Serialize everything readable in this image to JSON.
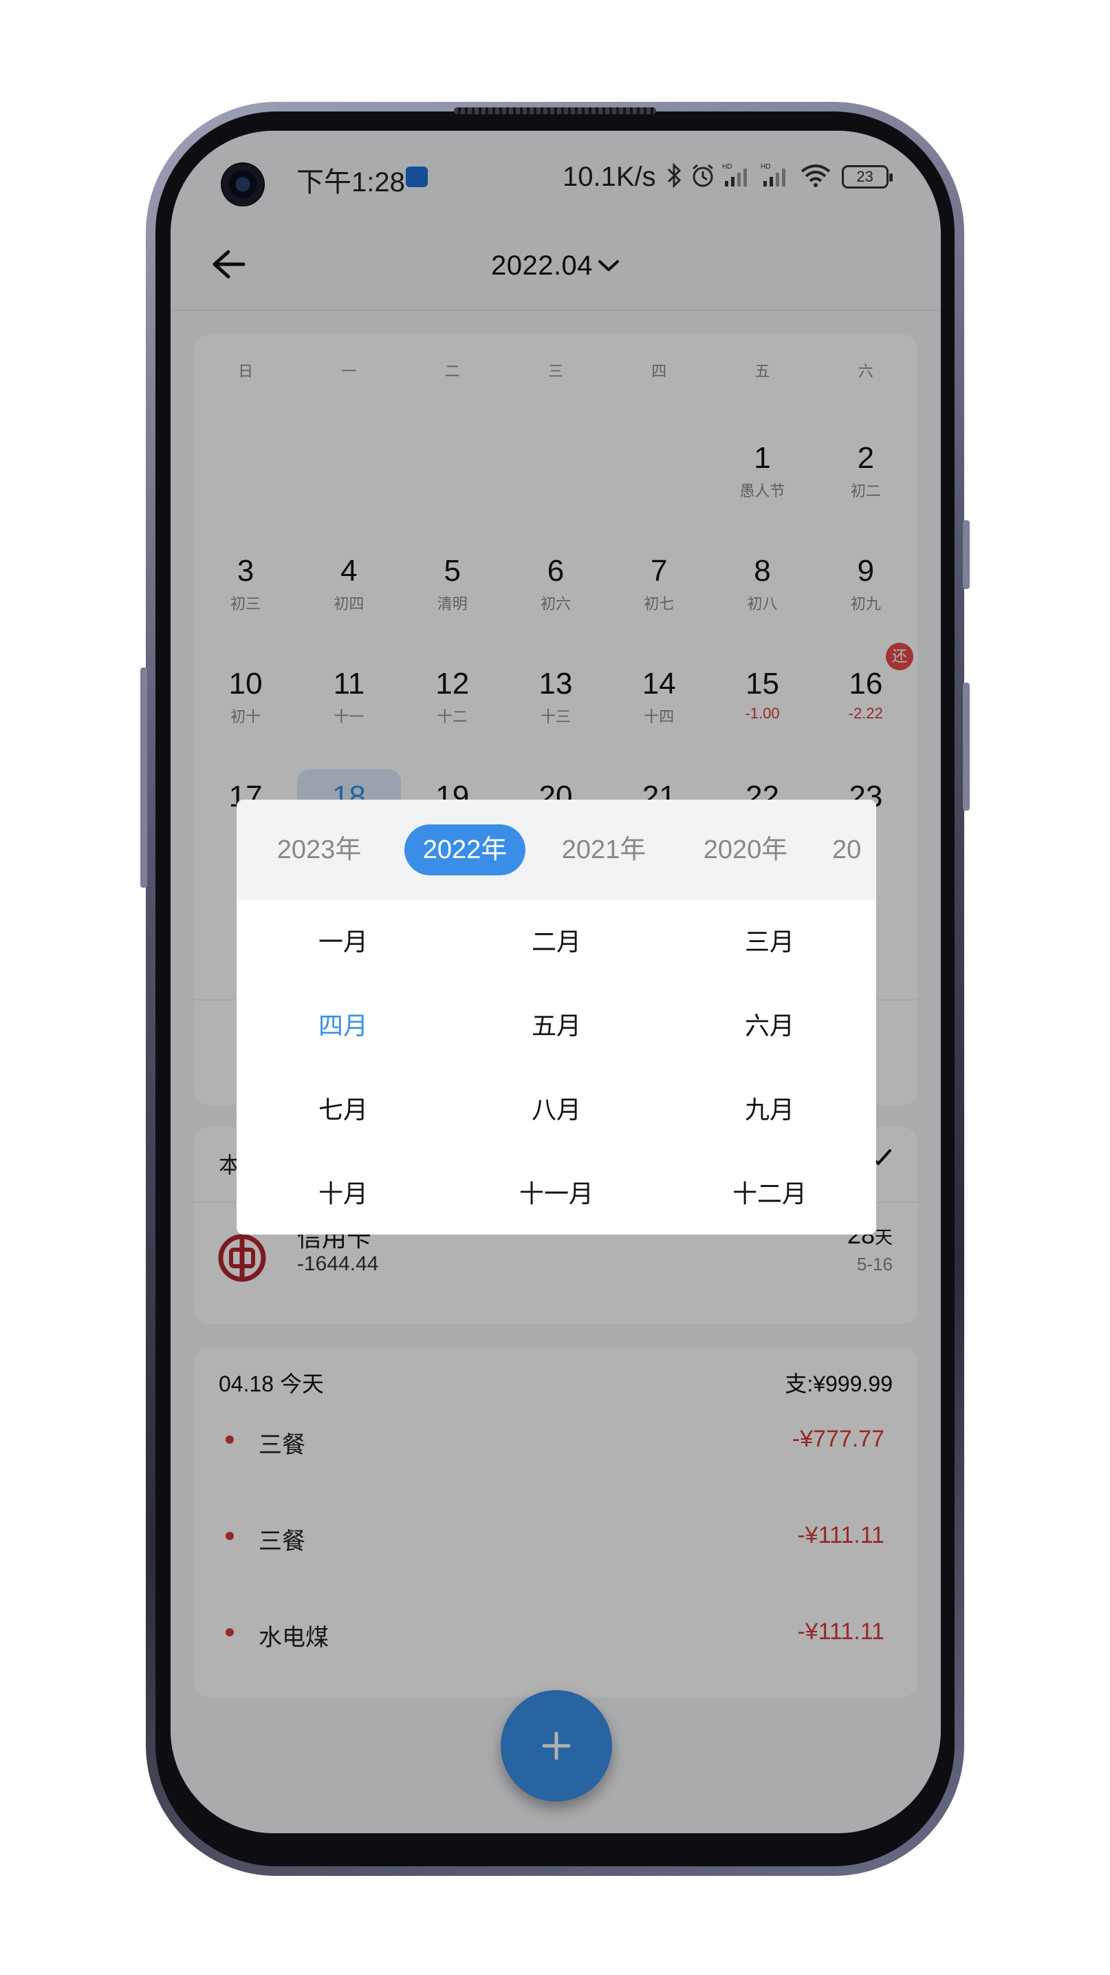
{
  "status_bar": {
    "time": "下午1:28",
    "net_speed": "10.1K/s",
    "battery": "23"
  },
  "header": {
    "title": "2022.04",
    "back_icon": "arrow-left-icon",
    "dropdown_icon": "chevron-down-icon"
  },
  "calendar": {
    "weekdays": [
      "日",
      "一",
      "二",
      "三",
      "四",
      "五",
      "六"
    ],
    "rows": [
      [
        {
          "day": "",
          "sub": ""
        },
        {
          "day": "",
          "sub": ""
        },
        {
          "day": "",
          "sub": ""
        },
        {
          "day": "",
          "sub": ""
        },
        {
          "day": "",
          "sub": ""
        },
        {
          "day": "1",
          "sub": "愚人节"
        },
        {
          "day": "2",
          "sub": "初二"
        }
      ],
      [
        {
          "day": "3",
          "sub": "初三"
        },
        {
          "day": "4",
          "sub": "初四"
        },
        {
          "day": "5",
          "sub": "清明"
        },
        {
          "day": "6",
          "sub": "初六"
        },
        {
          "day": "7",
          "sub": "初七"
        },
        {
          "day": "8",
          "sub": "初八"
        },
        {
          "day": "9",
          "sub": "初九"
        }
      ],
      [
        {
          "day": "10",
          "sub": "初十"
        },
        {
          "day": "11",
          "sub": "十一"
        },
        {
          "day": "12",
          "sub": "十二"
        },
        {
          "day": "13",
          "sub": "十三"
        },
        {
          "day": "14",
          "sub": "十四"
        },
        {
          "day": "15",
          "sub": "-1.00",
          "negative": true
        },
        {
          "day": "16",
          "sub": "-2.22",
          "negative": true,
          "badge": "还"
        }
      ],
      [
        {
          "day": "17",
          "sub": ""
        },
        {
          "day": "18",
          "sub": "",
          "selected": true
        },
        {
          "day": "19",
          "sub": ""
        },
        {
          "day": "20",
          "sub": ""
        },
        {
          "day": "21",
          "sub": ""
        },
        {
          "day": "22",
          "sub": ""
        },
        {
          "day": "23",
          "sub": ""
        }
      ]
    ]
  },
  "repayment": {
    "header_partial": "本",
    "card_name": "信用卡",
    "amount": "-1644.44",
    "days_left": "28",
    "days_unit": "天",
    "due_date": "5-16"
  },
  "transactions": {
    "date_label": "04.18 今天",
    "total": "支:¥999.99",
    "items": [
      {
        "name": "三餐",
        "amount": "-¥777.77"
      },
      {
        "name": "三餐",
        "amount": "-¥111.11"
      },
      {
        "name": "水电煤",
        "amount": "-¥111.11"
      }
    ]
  },
  "fab": {
    "icon": "plus-icon"
  },
  "picker": {
    "years": [
      {
        "label": "2023年",
        "active": false
      },
      {
        "label": "2022年",
        "active": true
      },
      {
        "label": "2021年",
        "active": false
      },
      {
        "label": "2020年",
        "active": false
      },
      {
        "label": "20",
        "active": false
      }
    ],
    "months": [
      [
        "一月",
        "二月",
        "三月"
      ],
      [
        "四月",
        "五月",
        "六月"
      ],
      [
        "七月",
        "八月",
        "九月"
      ],
      [
        "十月",
        "十一月",
        "十二月"
      ]
    ],
    "active_month": "四月"
  },
  "colors": {
    "accent": "#3a8ee8",
    "negative": "#d93a3a",
    "overlay": "rgba(0,0,0,0.30)"
  }
}
